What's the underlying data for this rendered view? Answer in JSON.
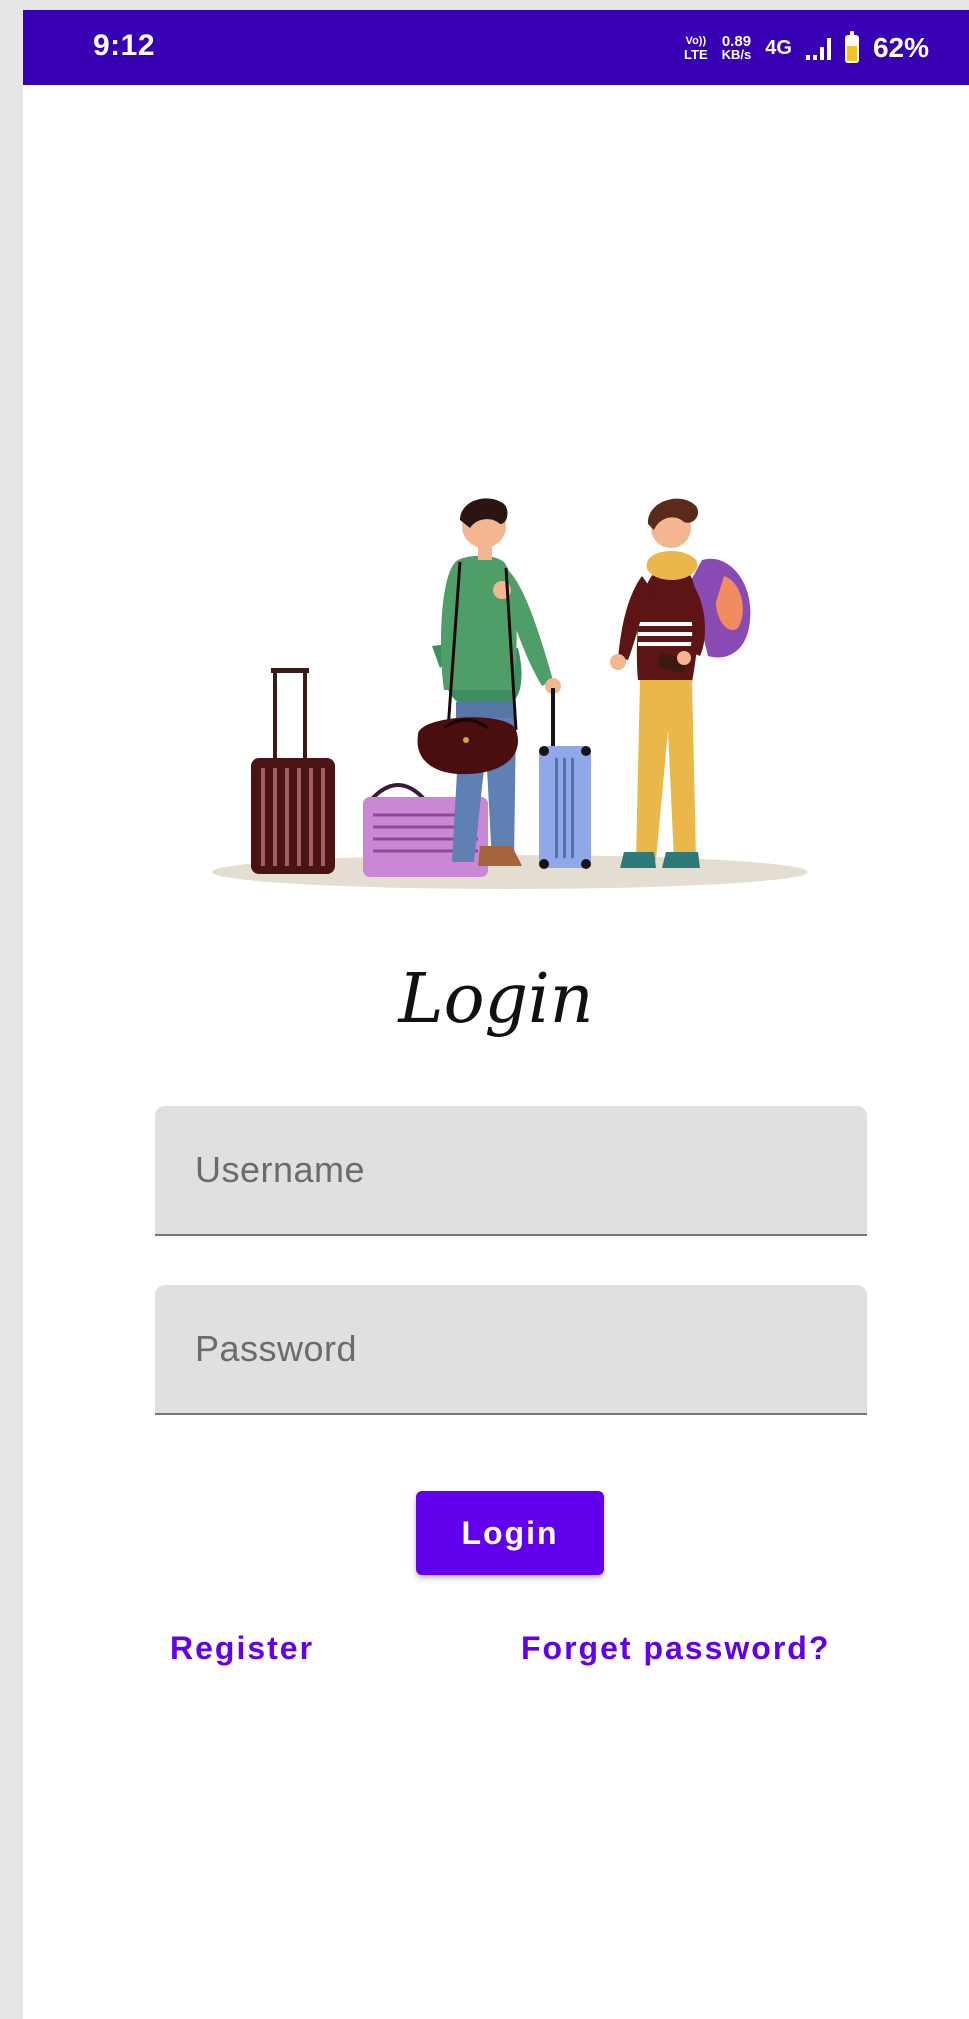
{
  "status_bar": {
    "time": "9:12",
    "volte_top": "Vo))",
    "volte_bottom": "LTE",
    "speed_top": "0.89",
    "speed_bottom": "KB/s",
    "network": "4G",
    "battery_level": 0.62,
    "battery_text": "62%"
  },
  "login": {
    "title": "Login",
    "username_placeholder": "Username",
    "username_value": "",
    "password_placeholder": "Password",
    "password_value": "",
    "button_label": "Login",
    "register_label": "Register",
    "forgot_label": "Forget password?"
  },
  "colors": {
    "status_bar": "#3700b3",
    "accent": "#6200ee",
    "field_bg": "#e0e0e0"
  }
}
